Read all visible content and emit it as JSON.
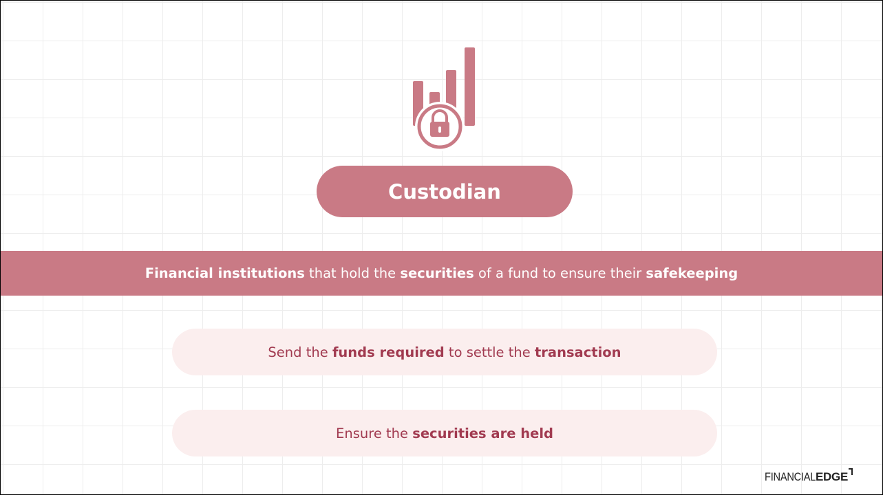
{
  "icon": {
    "name": "bar-chart-lock-icon",
    "color": "#c97a85"
  },
  "title": "Custodian",
  "definition": [
    {
      "text": "Financial institutions",
      "bold": true
    },
    {
      "text": " that hold the ",
      "bold": false
    },
    {
      "text": "securities",
      "bold": true
    },
    {
      "text": " of a fund to ensure their ",
      "bold": false
    },
    {
      "text": "safekeeping",
      "bold": true
    }
  ],
  "roles": [
    [
      {
        "text": "Send the ",
        "bold": false
      },
      {
        "text": "funds required",
        "bold": true
      },
      {
        "text": " to settle the ",
        "bold": false
      },
      {
        "text": "transaction",
        "bold": true
      }
    ],
    [
      {
        "text": "Ensure the ",
        "bold": false
      },
      {
        "text": "securities are held",
        "bold": true
      }
    ]
  ],
  "logo": {
    "part1": "FINANCIAL",
    "part2": "EDGE"
  },
  "colors": {
    "accent": "#c97a85",
    "pill_bg": "#fbeeee",
    "pill_text": "#a13a50"
  }
}
